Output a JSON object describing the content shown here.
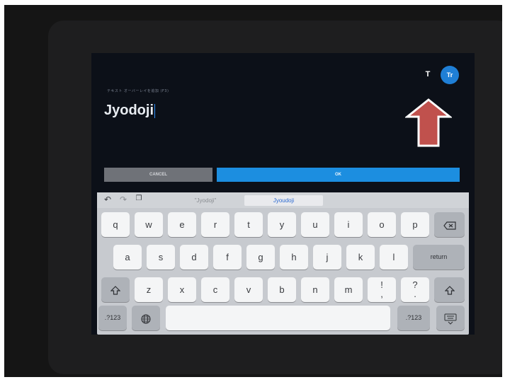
{
  "screen": {
    "overlay_label": "テキスト オーバーレイを追加 (F3)",
    "text_value": "Jyodoji",
    "text_style_button": "T",
    "font_button": "Tr",
    "cancel_label": "CANCEL",
    "ok_label": "OK"
  },
  "keyboard": {
    "suggestions": [
      "\"Jyodoji\"",
      "Jyoudoji",
      ""
    ],
    "row1": [
      "q",
      "w",
      "e",
      "r",
      "t",
      "y",
      "u",
      "i",
      "o",
      "p"
    ],
    "row2": [
      "a",
      "s",
      "d",
      "f",
      "g",
      "h",
      "j",
      "k",
      "l"
    ],
    "row3": [
      "z",
      "x",
      "c",
      "v",
      "b",
      "n",
      "m"
    ],
    "punct1": [
      "!",
      ","
    ],
    "punct2": [
      "?",
      "."
    ],
    "return_label": "return",
    "numbers_label": ".?123"
  },
  "colors": {
    "accent": "#1c8ee0",
    "arrow": "#c0514d"
  },
  "icons": [
    "undo-icon",
    "redo-icon",
    "paste-icon",
    "backspace-icon",
    "shift-icon",
    "globe-icon",
    "keyboard-dismiss-icon",
    "up-arrow"
  ]
}
